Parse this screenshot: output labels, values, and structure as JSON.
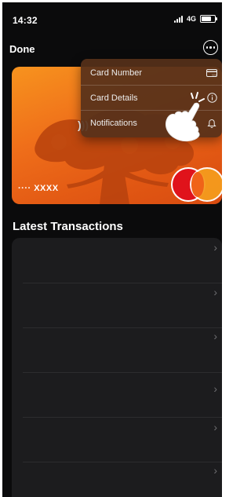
{
  "status_bar": {
    "time": "14:32",
    "network": "4G"
  },
  "nav": {
    "done_label": "Done"
  },
  "card": {
    "number": "···· XXXX",
    "contactless_symbol": ")))"
  },
  "menu": {
    "items": [
      {
        "label": "Card Number",
        "icon": "card-icon"
      },
      {
        "label": "Card Details",
        "icon": "info-icon"
      },
      {
        "label": "Notifications",
        "icon": "bell-icon"
      }
    ]
  },
  "transactions": {
    "title": "Latest Transactions",
    "rows": [
      {
        "chevron": "›"
      },
      {
        "chevron": "›"
      },
      {
        "chevron": "›"
      },
      {
        "chevron": "›"
      },
      {
        "chevron": "›"
      },
      {
        "chevron": "›"
      }
    ]
  },
  "colors": {
    "card_gradient_start": "#f7931e",
    "card_gradient_end": "#d84b10",
    "menu_bg": "#56301a",
    "background": "#0b0b0c",
    "list_bg": "#1c1c1e",
    "mastercard_red": "#e0131b",
    "mastercard_orange": "#f59b1e"
  }
}
